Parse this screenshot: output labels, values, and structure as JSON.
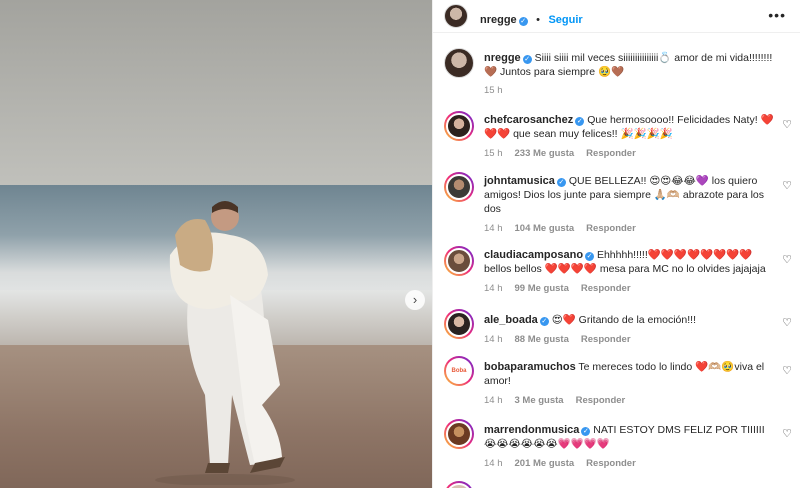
{
  "post_author": {
    "username": "nregge",
    "follow_label": "Seguir",
    "more_icon": "more-horizontal-icon"
  },
  "caption": {
    "username": "nregge",
    "text_a": "Siiii siiii mil veces siiiiiiiiiiiiiii",
    "ring_emoji": "💍",
    "text_b": " amor de mi vida!!!!!!!!",
    "heart_a": "🤎",
    "text_c": " Juntos para siempre ",
    "smile": "🥹",
    "heart_b": "🤎",
    "time": "15 h"
  },
  "comments": [
    {
      "username": "chefcarosanchez",
      "text": "Que hermosoooo!! Felicidades Naty! ❤️❤️❤️ que sean muy felices!! 🎉🎉🎉🎉",
      "time": "15 h",
      "likes": "233 Me gusta",
      "reply": "Responder"
    },
    {
      "username": "johntamusica",
      "text": "QUE BELLEZA!! 😍😍😂😂💜 los quiero amigos! Dios los junte para siempre 🙏🏼🫶🏼 abrazote para los dos",
      "time": "14 h",
      "likes": "104 Me gusta",
      "reply": "Responder"
    },
    {
      "username": "claudiacamposano",
      "text": "Ehhhhh!!!!!❤️❤️❤️❤️❤️❤️❤️❤️ bellos bellos ❤️❤️❤️❤️ mesa para MC no lo olvides jajajaja",
      "time": "14 h",
      "likes": "99 Me gusta",
      "reply": "Responder"
    },
    {
      "username": "ale_boada",
      "text": "😍❤️ Gritando de la emoción!!!",
      "time": "14 h",
      "likes": "88 Me gusta",
      "reply": "Responder"
    },
    {
      "username": "bobaparamuchos",
      "text": "Te mereces todo lo lindo ❤️🫶🏼🥹viva el amor!",
      "time": "14 h",
      "likes": "3 Me gusta",
      "reply": "Responder"
    },
    {
      "username": "marrendonmusica",
      "text": "NATI ESTOY DMS FELIZ POR TIIIIII 😭😭😭😭😭😭💗💗💗💗",
      "time": "14 h",
      "likes": "201 Me gusta",
      "reply": "Responder"
    }
  ],
  "icons": {
    "like": "heart-outline-icon",
    "verified": "verified-badge-icon",
    "carousel_next": "chevron-right-icon"
  },
  "colors": {
    "accent": "#0095f6",
    "verified": "#3897f0",
    "muted": "#8e8e8e"
  }
}
